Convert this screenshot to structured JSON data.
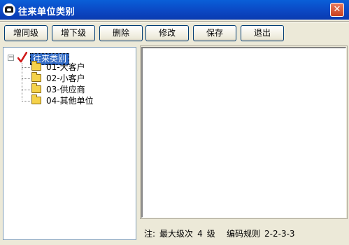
{
  "window": {
    "title": "往来单位类别",
    "close_glyph": "✕"
  },
  "toolbar": {
    "buttons": [
      {
        "label": "增同级"
      },
      {
        "label": "增下级"
      },
      {
        "label": "删除"
      },
      {
        "label": "修改"
      },
      {
        "label": "保存"
      },
      {
        "label": "退出"
      }
    ]
  },
  "tree": {
    "root": {
      "label": "往来类别",
      "expander": "−",
      "icon": "check-icon"
    },
    "items": [
      {
        "label": "01-大客户",
        "icon": "folder-icon"
      },
      {
        "label": "02-小客户",
        "icon": "folder-icon"
      },
      {
        "label": "03-供应商",
        "icon": "folder-icon"
      },
      {
        "label": "04-其他单位",
        "icon": "folder-icon"
      }
    ]
  },
  "status": {
    "note_prefix": "注:",
    "max_level_label": "最大级次",
    "max_level_value": "4",
    "max_level_unit": "级",
    "rule_label": "编码规则",
    "rule_value": "2-2-3-3"
  },
  "colors": {
    "titlebar": "#0b48c4",
    "selection": "#316ac5",
    "folder": "#f5d24a",
    "check": "#d01818",
    "window_bg": "#ece9d8"
  }
}
